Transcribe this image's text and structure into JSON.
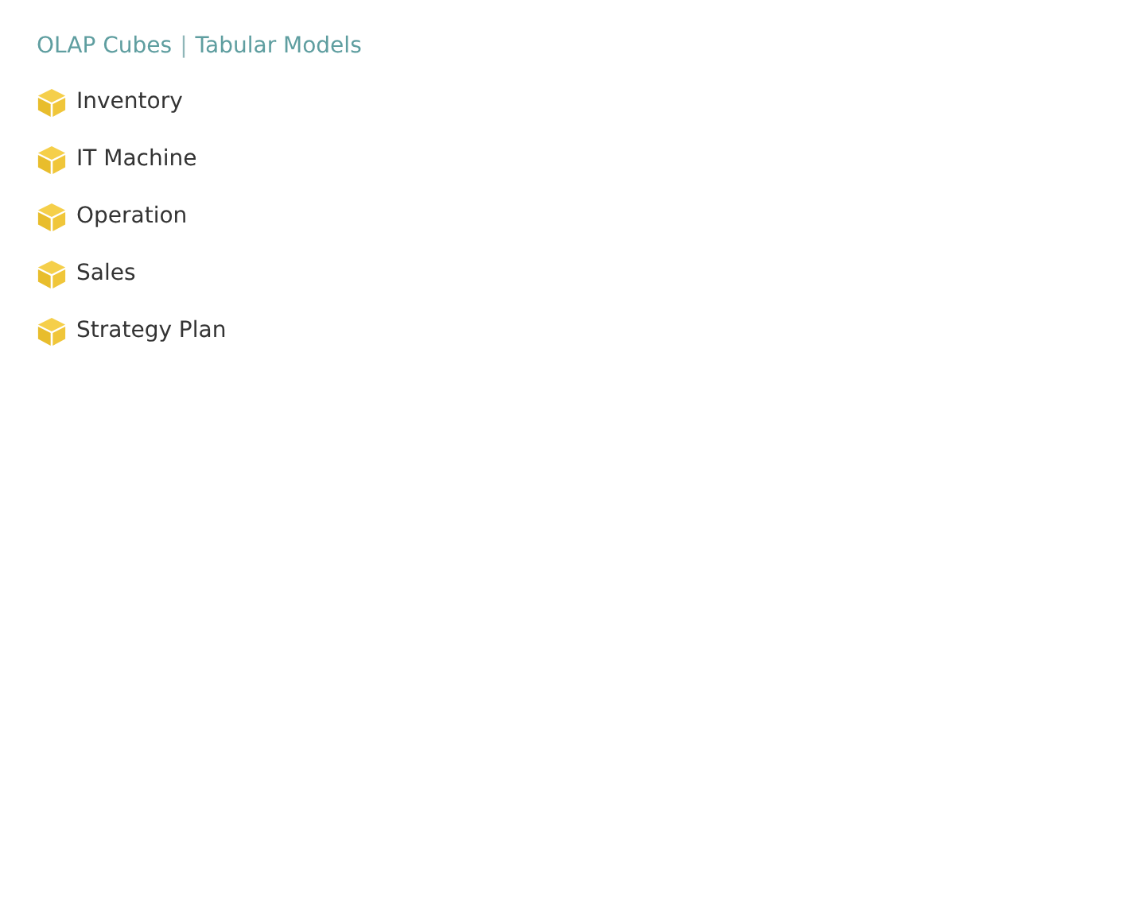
{
  "header": {
    "links": [
      "OLAP Cubes",
      "Tabular Models"
    ],
    "separator": "|"
  },
  "cubes": [
    {
      "label": "Inventory"
    },
    {
      "label": "IT Machine"
    },
    {
      "label": "Operation"
    },
    {
      "label": "Sales"
    },
    {
      "label": "Strategy Plan"
    }
  ]
}
